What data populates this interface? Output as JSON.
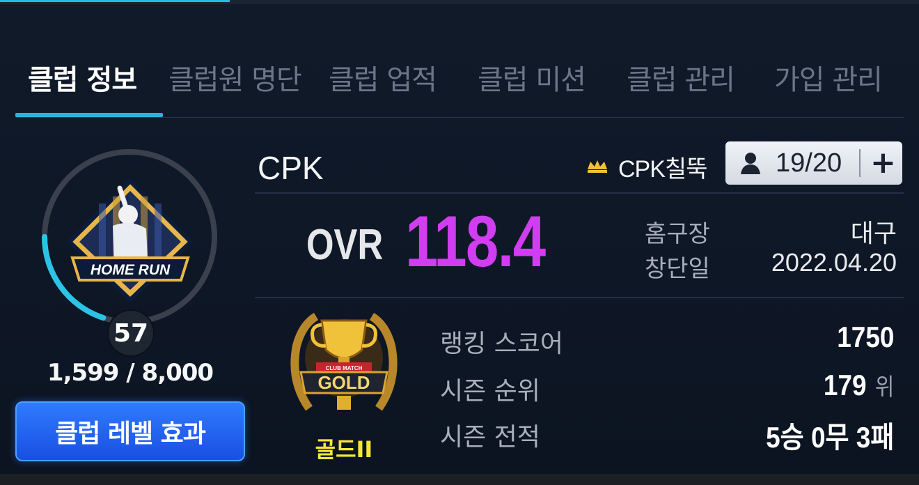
{
  "tabs": [
    {
      "label": "클럽 정보"
    },
    {
      "label": "클럽원 명단"
    },
    {
      "label": "클럽 업적"
    },
    {
      "label": "클럽 미션"
    },
    {
      "label": "클럽 관리"
    },
    {
      "label": "가입 관리"
    }
  ],
  "club": {
    "name": "CPK",
    "emblem_text": "HOME RUN",
    "leader": "CPK칠뚝",
    "members": "19/20",
    "add_label": "+"
  },
  "level": {
    "value": "57",
    "exp": "1,599 / 8,000",
    "exp_fraction": 0.2,
    "button_label": "클럽 레벨 효과"
  },
  "ovr": {
    "label": "OVR",
    "value": "118.4"
  },
  "info": {
    "home_label": "홈구장",
    "home_value": "대구",
    "founded_label": "창단일",
    "founded_value": "2022.04.20"
  },
  "tier": {
    "name": "골드II",
    "badge_text": "GOLD",
    "badge_subtext": "CLUB MATCH"
  },
  "stats": {
    "ranking_label": "랭킹 스코어",
    "ranking_value": "1750",
    "season_rank_label": "시즌 순위",
    "season_rank_value": "179",
    "season_rank_unit": "위",
    "season_record_label": "시즌 전적",
    "season_record_value": "5승 0무 3패"
  },
  "colors": {
    "accent": "#2ab3e0",
    "ovr": "#d13df0",
    "tier": "#f5e63a",
    "button": "#1a4fe0"
  }
}
